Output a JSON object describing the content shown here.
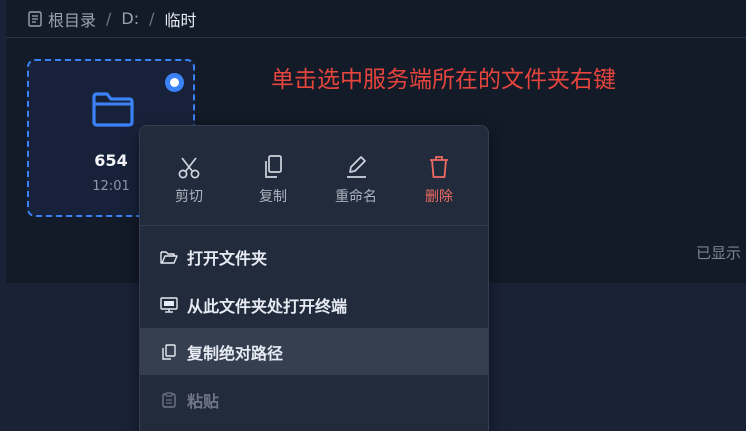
{
  "breadcrumb": {
    "root": "根目录",
    "sep1": "/",
    "drive": "D:",
    "sep2": "/",
    "current": "临时"
  },
  "folder": {
    "name": "654",
    "time": "12:01",
    "selected": true
  },
  "annotation": "单击选中服务端所在的文件夹右键",
  "status_text": "已显示",
  "context_menu": {
    "quick_actions": {
      "cut": "剪切",
      "copy": "复制",
      "rename": "重命名",
      "delete": "删除"
    },
    "items": {
      "open_folder": "打开文件夹",
      "open_terminal": "从此文件夹处打开终端",
      "copy_path": "复制绝对路径",
      "paste": "粘贴"
    }
  },
  "colors": {
    "accent": "#3b82f6",
    "danger": "#ef6b63",
    "annotation": "#e5453d"
  },
  "icons": {
    "breadcrumb": "document-list-icon",
    "folder": "folder-icon",
    "cut": "scissors-icon",
    "copy": "copy-icon",
    "rename": "pencil-icon",
    "delete": "trash-icon",
    "open_folder": "folder-open-icon",
    "terminal": "terminal-icon",
    "copy_path": "copy-icon",
    "paste": "clipboard-icon"
  }
}
